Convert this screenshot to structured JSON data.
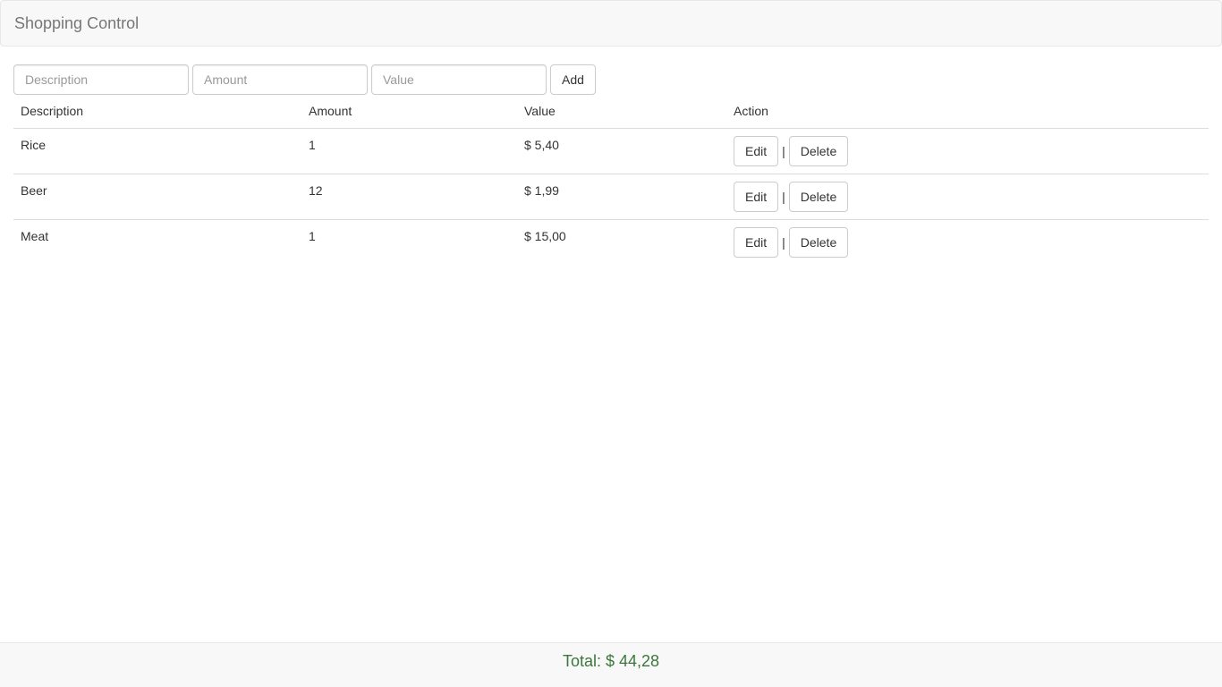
{
  "navbar": {
    "brand": "Shopping Control"
  },
  "form": {
    "description_placeholder": "Description",
    "amount_placeholder": "Amount",
    "value_placeholder": "Value",
    "add_label": "Add"
  },
  "table": {
    "headers": [
      "Description",
      "Amount",
      "Value",
      "Action"
    ],
    "rows": [
      {
        "description": "Rice",
        "amount": "1",
        "value": "$ 5,40"
      },
      {
        "description": "Beer",
        "amount": "12",
        "value": "$ 1,99"
      },
      {
        "description": "Meat",
        "amount": "1",
        "value": "$ 15,00"
      }
    ],
    "edit_label": "Edit",
    "separator": "|",
    "delete_label": "Delete"
  },
  "footer": {
    "total": "Total: $ 44,28"
  },
  "colors": {
    "total_text": "#3c763d",
    "navbar_bg": "#f8f8f8"
  }
}
